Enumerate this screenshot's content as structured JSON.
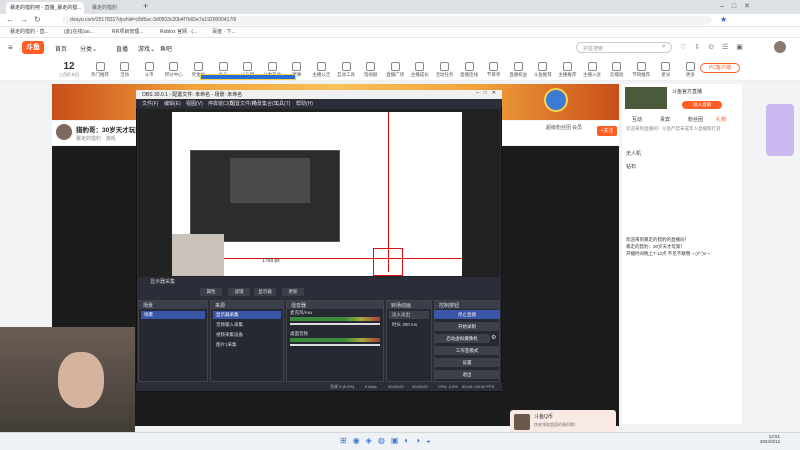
{
  "browser": {
    "tab_title": "暴走的猎豹吧 - 直播_暴走的猎...",
    "tab_title2": "暴走的猎豹",
    "url": "douyu.com/2517831?dyshid=c8d5ac-3d0503c20b4f7b65e7a19200004170l",
    "bookmarks": [
      "暴走的猎豹 - 直...",
      "(此)在线(ao...",
      "RR项目管理...",
      "Roblox 官网 · (...",
      "百度 · 下..."
    ]
  },
  "douyu": {
    "logo": "斗鱼",
    "nav": [
      "首页",
      "分类",
      "直播",
      "游戏",
      "鱼吧"
    ],
    "search_placeholder": "护星搜索",
    "date_day": "12",
    "date_label": "三月打卡日",
    "icons": [
      "热门推荐",
      "活动",
      "斗币",
      "积分中心",
      "奖金台",
      "会员",
      "小礼物",
      "分类互动",
      "赛事",
      "主播公告",
      "互动工具",
      "电视剧",
      "直播广场",
      "主播成长",
      "活动任务",
      "直播连线",
      "节目单",
      "直播权益",
      "斗鱼推荐",
      "主播推荐",
      "主播入驻",
      "云播放",
      "节目推荐",
      "星光",
      "更多"
    ],
    "pc_client": "PC客户端",
    "room_title": "猎豹哥：30岁天才玩家",
    "room_sub": "暴走的猎豹 · 游戏",
    "follow": "+关注",
    "gift_labels": [
      "超级粉丝团",
      "会员"
    ],
    "right": {
      "host_name": "斗鱼官方直播",
      "enter": "进入直播",
      "tabs": [
        "互动",
        "贵宾",
        "粉丝团",
        "礼物"
      ],
      "notice": "欢迎来到直播间！斗鱼严禁未成年人直播和打赏",
      "gifts": [
        "无人机",
        "钻石"
      ],
      "chat": [
        "欢迎来到暴走的猎豹的直播间！",
        "暴走的猎豹：30岁天才玩家！",
        "开播时间晚上7-12点 不见不散哦 ~ (ง'̀-'́)ง ~"
      ]
    }
  },
  "obs": {
    "title": "OBS 30.0.1 - 配置文件: 未命名 - 场景: 未命名",
    "menu": [
      "文件(F)",
      "编辑(E)",
      "视图(V)",
      "停靠窗口(D)",
      "配置文件(P)",
      "场景集合(S)",
      "工具(T)",
      "帮助(H)"
    ],
    "source_label": "显示器采集",
    "toolbar": [
      "属性",
      "滤镜",
      "显示器",
      "更新"
    ],
    "docks": {
      "scenes": {
        "title": "场景",
        "items": [
          "场景"
        ]
      },
      "sources": {
        "title": "来源",
        "items": [
          "显示器采集",
          "音频输入采集",
          "视频采集设备",
          "图片1采集"
        ]
      },
      "mixer": {
        "title": "混音器",
        "channels": [
          {
            "name": "麦克风/Aux",
            "db": "0.0 dB"
          },
          {
            "name": "桌面音频",
            "db": "0.0 dB"
          }
        ]
      },
      "transitions": {
        "title": "转场动画",
        "type": "淡入淡出",
        "duration_label": "时长",
        "duration": "300 ms"
      },
      "controls": {
        "title": "控制按钮",
        "buttons": [
          "停止直播",
          "开始录制",
          "启动虚拟摄像机",
          "工作室模式",
          "设置",
          "退出"
        ]
      }
    },
    "status": {
      "dropped": "丢帧 0 (0.0%)",
      "kbps": "0 kbps",
      "live": "00:00:00",
      "rec": "00:00:00",
      "cpu": "CPU: 2.0%",
      "fps": "60.00 / 60.00 FPS"
    },
    "inner_label": "1768 px"
  },
  "popup": {
    "title": "斗鱼Q币",
    "sub": "快来领取超值的福利哦！"
  },
  "clock": {
    "time": "13:51",
    "date": "2024/3/12"
  },
  "colors": {
    "brand": "#ff5d23",
    "accent": "#5470c6"
  }
}
